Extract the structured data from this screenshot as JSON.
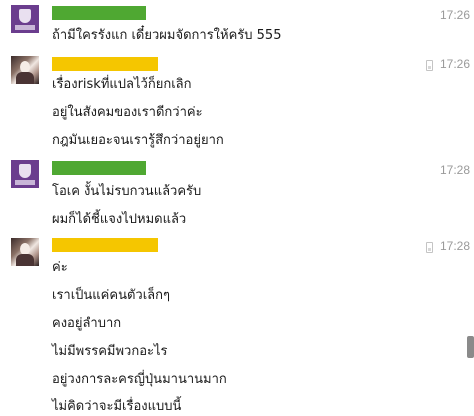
{
  "messages": [
    {
      "sender_color": "#4fa832",
      "avatar": "university-logo-avatar",
      "time": "17:26",
      "lines": [
        "ถ้ามีใครรังแก เดี๋ยวผมจัดการให้ครับ 555"
      ]
    },
    {
      "sender_color": "#f5c600",
      "avatar": "profile-photo-avatar",
      "time": "17:26",
      "lines": [
        "เรื่องriskที่แปลไว้ก็ยกเลิก",
        "อยู่ในสังคมของเราดีกว่าค่ะ",
        "กฎมันเยอะจนเรารู้สึกว่าอยู่ยาก"
      ]
    },
    {
      "sender_color": "#4fa832",
      "avatar": "university-logo-avatar",
      "time": "17:28",
      "lines": [
        "โอเค งั้นไม่รบกวนแล้วครับ",
        "ผมก็ได้ชี้แจงไปหมดแล้ว"
      ]
    },
    {
      "sender_color": "#f5c600",
      "avatar": "profile-photo-avatar",
      "time": "17:28",
      "lines": [
        "ค่ะ",
        "เราเป็นแค่คนตัวเล็กๆ",
        "คงอยู่ลำบาก",
        "ไม่มีพรรคมีพวกอะไร",
        "อยู่วงการละครญี่ปุ่นมานานมาก",
        "ไม่คิดว่าจะมีเรื่องแบบนี้"
      ]
    }
  ]
}
